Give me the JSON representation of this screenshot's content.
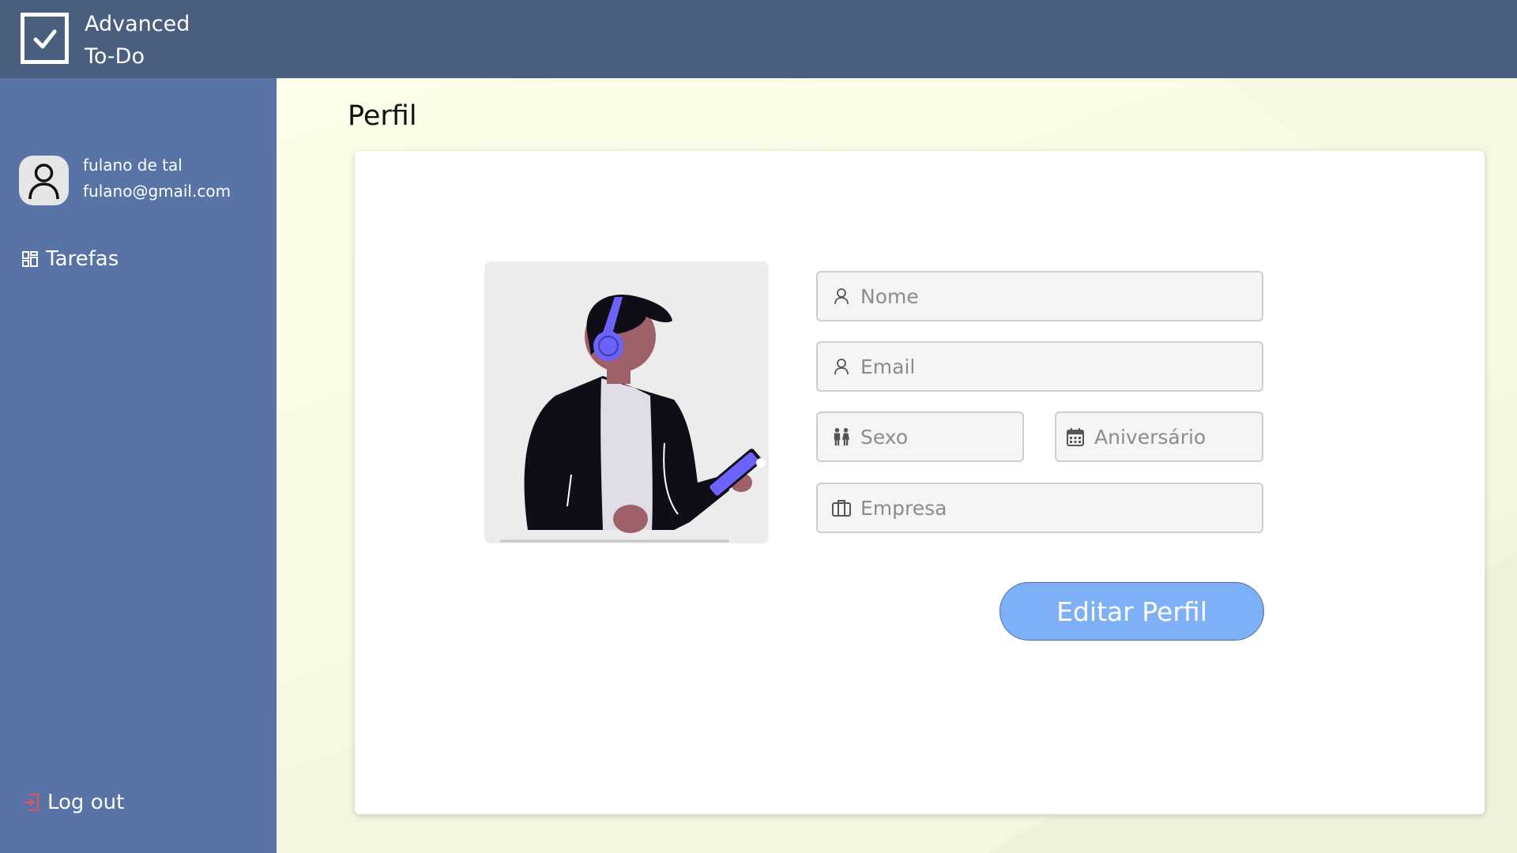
{
  "app": {
    "title_line1": "Advanced",
    "title_line2": "To-Do"
  },
  "user": {
    "name": "fulano de tal",
    "email": "fulano@gmail.com"
  },
  "sidebar": {
    "items": [
      {
        "label": "Tarefas",
        "icon": "grid-icon"
      }
    ],
    "logout_label": "Log out",
    "logout_icon": "logout-icon"
  },
  "page": {
    "title": "Perfil"
  },
  "form": {
    "nome_placeholder": "Nome",
    "email_placeholder": "Email",
    "sexo_placeholder": "Sexo",
    "aniversario_placeholder": "Aniversário",
    "empresa_placeholder": "Empresa",
    "submit_label": "Editar Perfil"
  },
  "colors": {
    "header_bg": "#4a5e80",
    "sidebar_bg": "#5874a7",
    "main_bg": "#fafde8",
    "button_bg": "#7eb0f8",
    "logout_icon": "#e8505b",
    "accent_purple": "#6c63ff"
  }
}
